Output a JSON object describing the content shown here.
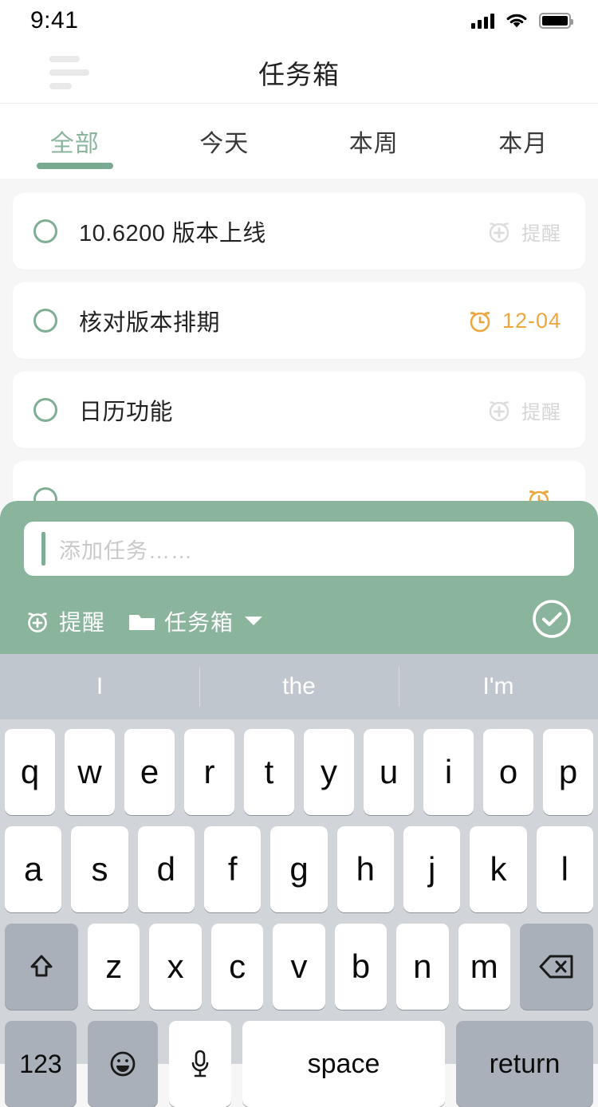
{
  "status_bar": {
    "time": "9:41",
    "icons": [
      "signal-bars-icon",
      "wifi-icon",
      "battery-icon"
    ]
  },
  "nav": {
    "title": "任务箱",
    "menu_icon": "menu-icon"
  },
  "tabs": [
    {
      "label": "全部",
      "active": true
    },
    {
      "label": "今天",
      "active": false
    },
    {
      "label": "本周",
      "active": false
    },
    {
      "label": "本月",
      "active": false
    }
  ],
  "tasks": [
    {
      "title": "10.6200 版本上线",
      "meta_label": "提醒",
      "meta_type": "reminder-add",
      "done": false
    },
    {
      "title": "核对版本排期",
      "meta_label": "12-04",
      "meta_type": "alarm-date",
      "done": false
    },
    {
      "title": "日历功能",
      "meta_label": "提醒",
      "meta_type": "reminder-add",
      "done": false
    },
    {
      "title": "",
      "meta_label": "",
      "meta_type": "alarm-date",
      "done": false
    }
  ],
  "compose": {
    "placeholder": "添加任务……",
    "value": "",
    "reminder_label": "提醒",
    "list_label": "任务箱",
    "confirm_icon": "check-circle-icon"
  },
  "keyboard": {
    "predictions": [
      "I",
      "the",
      "I'm"
    ],
    "row1": [
      "q",
      "w",
      "e",
      "r",
      "t",
      "y",
      "u",
      "i",
      "o",
      "p"
    ],
    "row2": [
      "a",
      "s",
      "d",
      "f",
      "g",
      "h",
      "j",
      "k",
      "l"
    ],
    "row3": [
      "z",
      "x",
      "c",
      "v",
      "b",
      "n",
      "m"
    ],
    "shift_icon": "shift-icon",
    "backspace_icon": "backspace-icon",
    "numbers_label": "123",
    "emoji_icon": "emoji-icon",
    "mic_icon": "microphone-icon",
    "space_label": "space",
    "return_label": "return"
  },
  "colors": {
    "accent_green": "#8ab49c",
    "accent_green_dark": "#7aa992",
    "orange": "#eda740",
    "muted_grey": "#d6d6d6",
    "page_bg": "#f6f6f6"
  }
}
